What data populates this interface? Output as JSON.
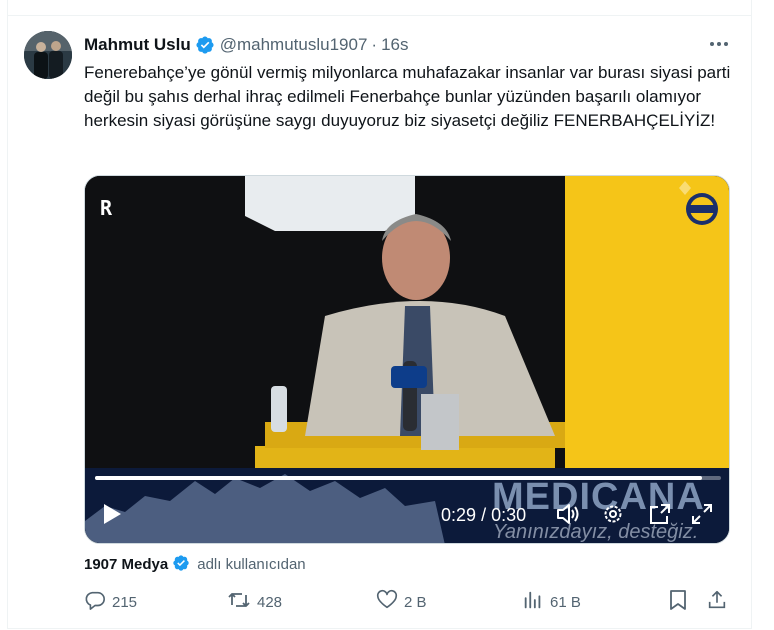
{
  "tweet": {
    "author_name": "Mahmut Uslu",
    "handle": "@mahmutuslu1907",
    "separator": "·",
    "time": "16s",
    "text": "Fenerebahçe’ye gönül vermiş milyonlarca muhafazakar insanlar var burası siyasi parti değil bu şahıs derhal ihraç edilmeli Fenerbahçe bunlar yüzünden başarılı olamıyor herkesin siyasi görüşüne saygı duyuyoruz biz siyasetçi değiliz FENERBAHÇELİYİZ!",
    "more_icon": "more-horizontal-icon",
    "verified_icon": "verified-badge-icon",
    "verified_color": "#1d9bf0"
  },
  "video": {
    "watermark_letter": "R",
    "sponsor_text": "MEDICANA",
    "sponsor_subtext": "Yanınızdayız, desteğiz.",
    "current_time": "0:29",
    "duration": "0:30",
    "time_separator": "/",
    "progress_fraction": 0.97,
    "icons": [
      "play-icon",
      "volume-icon",
      "settings-icon",
      "picture-in-picture-icon",
      "fullscreen-icon"
    ],
    "accent_yellow": "#f5c518"
  },
  "source": {
    "name": "1907 Medya",
    "text": "adlı kullanıcıdan",
    "icon": "verified-badge-icon"
  },
  "actions": {
    "reply_count": "215",
    "retweet_count": "428",
    "like_count": "2 B",
    "views_count": "61 B",
    "icons": [
      "reply-icon",
      "retweet-icon",
      "like-icon",
      "views-icon",
      "bookmark-icon",
      "share-icon"
    ],
    "muted_color": "#536471"
  }
}
